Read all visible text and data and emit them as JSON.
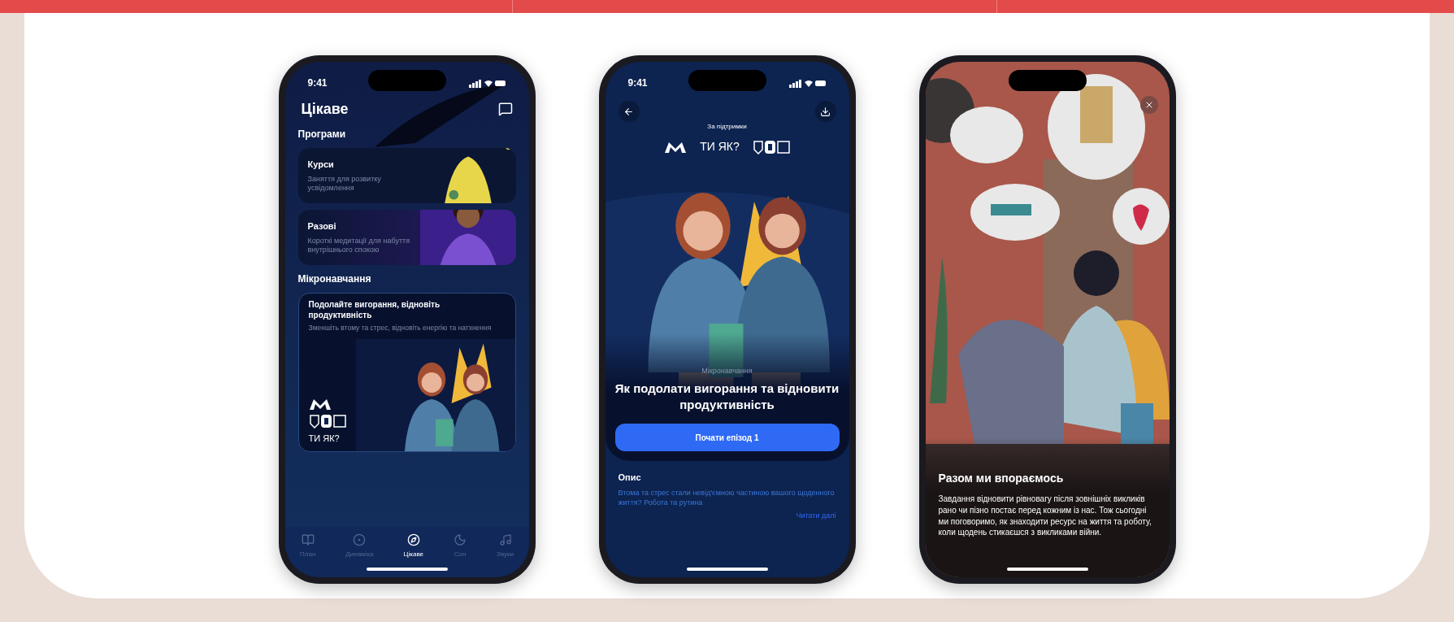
{
  "phones": [
    {
      "kind": "explore",
      "time": "9:41",
      "title": "Цікаве",
      "sections": [
        {
          "heading": "Програми",
          "cards": [
            {
              "kind": "program",
              "title": "Курси",
              "text": "Заняття для розвитку усвідомлення"
            },
            {
              "kind": "program",
              "title": "Разові",
              "text": "Короткі медитації для набуття внутрішнього спокою"
            }
          ]
        },
        {
          "heading": "Мікронавчання",
          "cards": [
            {
              "kind": "feature",
              "title": "Подолайте вигорання, відновіть продуктивність",
              "text": "Зменшіть втому та стрес, відновіть енергію та натхнення",
              "brand": "ТИ ЯК?"
            }
          ]
        }
      ],
      "tabs": [
        {
          "label": "План",
          "selected": false
        },
        {
          "label": "Динаміка",
          "selected": false
        },
        {
          "label": "Цікаве",
          "selected": true
        },
        {
          "label": "Сон",
          "selected": false
        },
        {
          "label": "Звуки",
          "selected": false
        }
      ]
    },
    {
      "kind": "episode",
      "time": "9:41",
      "support": "За підтримки",
      "brand": "ТИ ЯК?",
      "category": "Мікронавчання",
      "title": "Як подолати вигорання та відновити продуктивність",
      "button": "Почати епізод 1",
      "description_heading": "Опис",
      "description": "Втома та стрес стали невід'ємною частиною вашого щоденного життя? Робота та рутина",
      "more": "Читати далі"
    },
    {
      "kind": "story",
      "title": "Разом ми впораємось",
      "text": "Завдання відновити рівновагу після зовнішніх викликів рано чи пізно постає перед кожним із нас. Тож сьогодні ми поговоримо, як знаходити ресурс на життя та роботу, коли щодень стикаєшся з викликами війни."
    }
  ]
}
